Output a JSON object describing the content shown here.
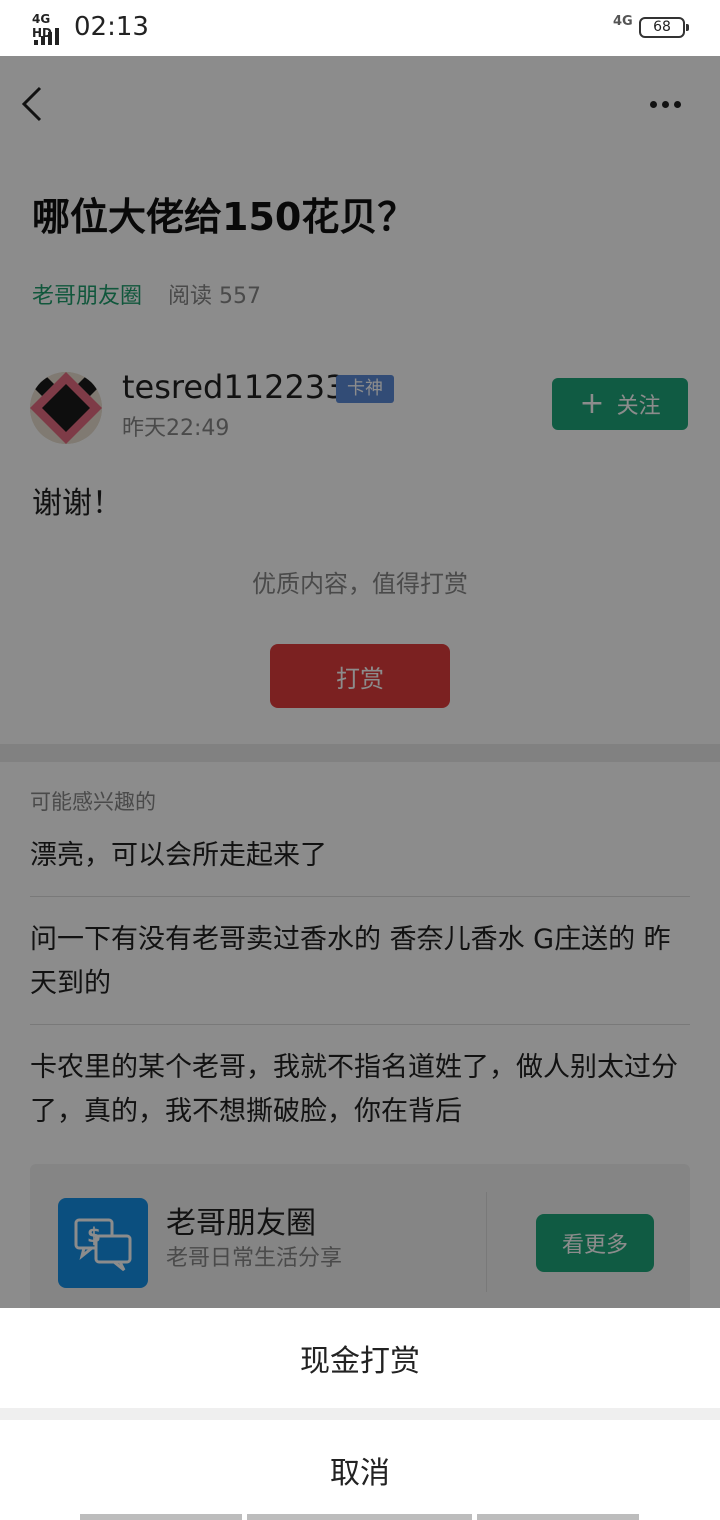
{
  "status_bar": {
    "signal_label": "4G HD",
    "time": "02:13",
    "network": "4G",
    "battery": "68"
  },
  "post": {
    "title": "哪位大佬给150花贝？",
    "circle": "老哥朋友圈",
    "read_count": "阅读 557",
    "author": "tesred112233",
    "badge": "卡神",
    "time": "昨天22:49",
    "follow_label": "关注",
    "content": "谢谢！",
    "reward_hint": "优质内容，值得打赏",
    "reward_label": "打赏"
  },
  "related": {
    "label": "可能感兴趣的",
    "items": [
      "漂亮，可以会所走起来了",
      "问一下有没有老哥卖过香水的 香奈儿香水 G庄送的 昨天到的",
      "卡农里的某个老哥，我就不指名道姓了，做人别太过分了，真的，我不想撕破脸，你在背后"
    ]
  },
  "circle_card": {
    "name": "老哥朋友圈",
    "desc": "老哥日常生活分享",
    "see_more": "看更多"
  },
  "action_sheet": {
    "option": "现金打赏",
    "cancel": "取消"
  }
}
